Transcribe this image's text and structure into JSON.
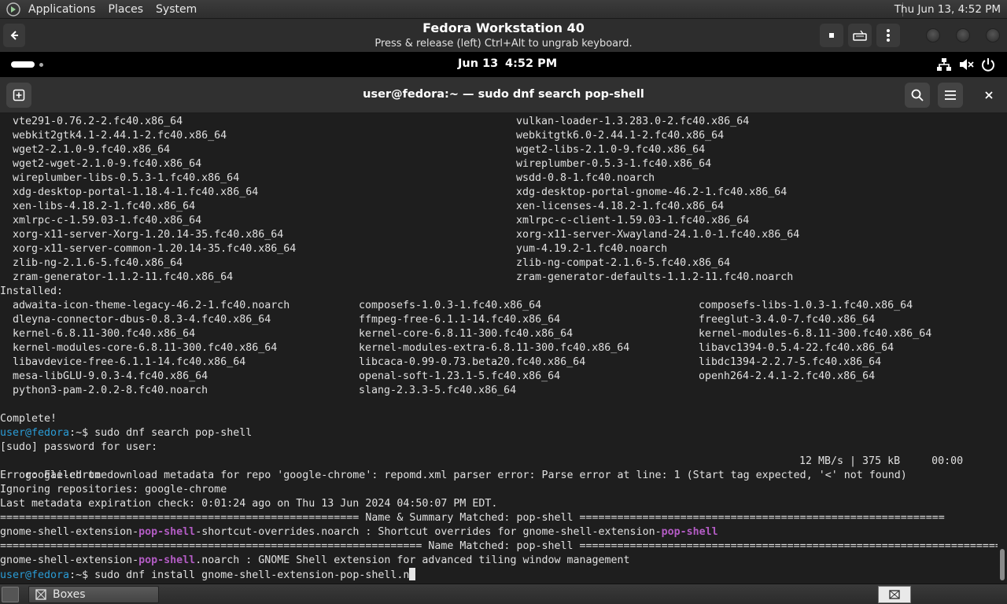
{
  "host_panel": {
    "menus": [
      "Applications",
      "Places",
      "System"
    ],
    "clock": "Thu Jun 13,  4:52 PM"
  },
  "boxes": {
    "title": "Fedora Workstation 40",
    "subtitle": "Press & release (left) Ctrl+Alt to ungrab keyboard."
  },
  "guest_bar": {
    "date": "Jun 13",
    "time": "4:52 PM"
  },
  "terminal": {
    "title": "user@fedora:~ — sudo dnf search pop-shell",
    "two_col_rows": [
      [
        "vte291-0.76.2-2.fc40.x86_64",
        "vulkan-loader-1.3.283.0-2.fc40.x86_64"
      ],
      [
        "webkit2gtk4.1-2.44.1-2.fc40.x86_64",
        "webkitgtk6.0-2.44.1-2.fc40.x86_64"
      ],
      [
        "wget2-2.1.0-9.fc40.x86_64",
        "wget2-libs-2.1.0-9.fc40.x86_64"
      ],
      [
        "wget2-wget-2.1.0-9.fc40.x86_64",
        "wireplumber-0.5.3-1.fc40.x86_64"
      ],
      [
        "wireplumber-libs-0.5.3-1.fc40.x86_64",
        "wsdd-0.8-1.fc40.noarch"
      ],
      [
        "xdg-desktop-portal-1.18.4-1.fc40.x86_64",
        "xdg-desktop-portal-gnome-46.2-1.fc40.x86_64"
      ],
      [
        "xen-libs-4.18.2-1.fc40.x86_64",
        "xen-licenses-4.18.2-1.fc40.x86_64"
      ],
      [
        "xmlrpc-c-1.59.03-1.fc40.x86_64",
        "xmlrpc-c-client-1.59.03-1.fc40.x86_64"
      ],
      [
        "xorg-x11-server-Xorg-1.20.14-35.fc40.x86_64",
        "xorg-x11-server-Xwayland-24.1.0-1.fc40.x86_64"
      ],
      [
        "xorg-x11-server-common-1.20.14-35.fc40.x86_64",
        "yum-4.19.2-1.fc40.noarch"
      ],
      [
        "zlib-ng-2.1.6-5.fc40.x86_64",
        "zlib-ng-compat-2.1.6-5.fc40.x86_64"
      ],
      [
        "zram-generator-1.1.2-11.fc40.x86_64",
        "zram-generator-defaults-1.1.2-11.fc40.noarch"
      ]
    ],
    "installed_label": "Installed:",
    "installed_rows": [
      [
        "adwaita-icon-theme-legacy-46.2-1.fc40.noarch",
        "composefs-1.0.3-1.fc40.x86_64",
        "composefs-libs-1.0.3-1.fc40.x86_64"
      ],
      [
        "dleyna-connector-dbus-0.8.3-4.fc40.x86_64",
        "ffmpeg-free-6.1.1-14.fc40.x86_64",
        "freeglut-3.4.0-7.fc40.x86_64"
      ],
      [
        "kernel-6.8.11-300.fc40.x86_64",
        "kernel-core-6.8.11-300.fc40.x86_64",
        "kernel-modules-6.8.11-300.fc40.x86_64"
      ],
      [
        "kernel-modules-core-6.8.11-300.fc40.x86_64",
        "kernel-modules-extra-6.8.11-300.fc40.x86_64",
        "libavc1394-0.5.4-22.fc40.x86_64"
      ],
      [
        "libavdevice-free-6.1.1-14.fc40.x86_64",
        "libcaca-0.99-0.73.beta20.fc40.x86_64",
        "libdc1394-2.2.7-5.fc40.x86_64"
      ],
      [
        "mesa-libGLU-9.0.3-4.fc40.x86_64",
        "openal-soft-1.23.1-5.fc40.x86_64",
        "openh264-2.4.1-2.fc40.x86_64"
      ],
      [
        "python3-pam-2.0.2-8.fc40.noarch",
        "slang-2.3.3-5.fc40.x86_64",
        ""
      ]
    ],
    "complete": "Complete!",
    "prompt": "user@fedora",
    "prompt_suffix": ":~$ ",
    "cmd1": "sudo dnf search pop-shell",
    "sudo_prompt": "[sudo] password for user:",
    "chrome_repo": "google-chrome",
    "chrome_stats": "12 MB/s | 375 kB     00:00",
    "error_line": "Error: Failed to download metadata for repo 'google-chrome': repomd.xml parser error: Parse error at line: 1 (Start tag expected, '<' not found)",
    "ignoring": "Ignoring repositories: google-chrome",
    "metadata_check": "Last metadata expiration check: 0:01:24 ago on Thu 13 Jun 2024 04:50:07 PM EDT.",
    "sep1": "========================================================= Name & Summary Matched: pop-shell ==========================================================",
    "match1_pre": "gnome-shell-extension-",
    "match1_hl": "pop-shell",
    "match1_mid": "-shortcut-overrides.noarch : Shortcut overrides for gnome-shell-extension-",
    "match1_hl2": "pop-shell",
    "sep2": "=================================================================== Name Matched: pop-shell ===================================================================",
    "match2_pre": "gnome-shell-extension-",
    "match2_hl": "pop-shell",
    "match2_post": ".noarch : GNOME Shell extension for advanced tiling window management",
    "cmd2": "sudo dnf install gnome-shell-extension-pop-shell.n"
  },
  "taskbar": {
    "task_label": "Boxes"
  },
  "colors": {
    "prompt": "#2a9cd6",
    "highlight": "#b35cc4",
    "terminal_bg": "#1e1e1e"
  }
}
